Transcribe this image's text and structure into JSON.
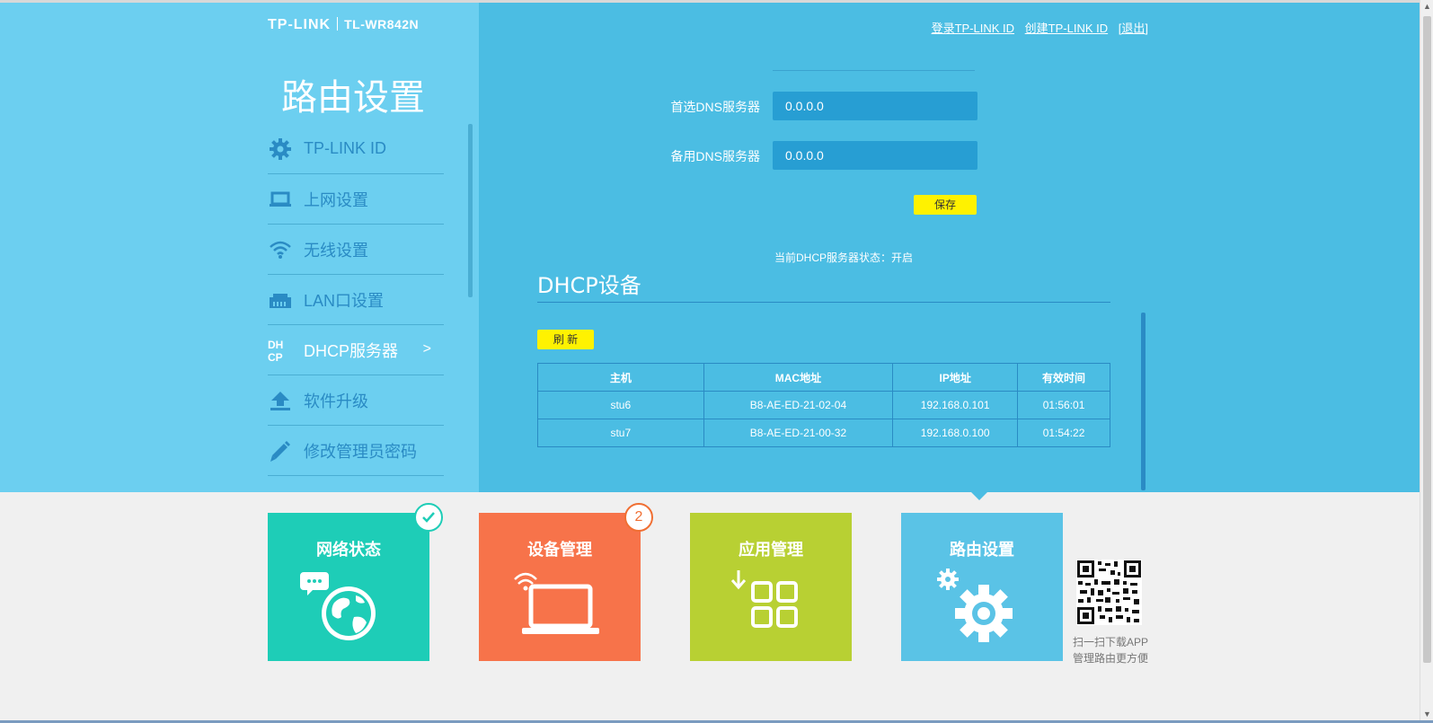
{
  "header": {
    "brand": "TP-LINK",
    "model": "TL-WR842N",
    "links": [
      "登录TP-LINK ID",
      "创建TP-LINK ID",
      "[退出]"
    ]
  },
  "sidebar": {
    "title": "路由设置",
    "items": [
      {
        "label": "TP-LINK ID",
        "icon": "gear-icon"
      },
      {
        "label": "上网设置",
        "icon": "laptop-icon"
      },
      {
        "label": "无线设置",
        "icon": "wifi-icon"
      },
      {
        "label": "LAN口设置",
        "icon": "lan-port-icon"
      },
      {
        "label": "DHCP服务器",
        "icon": "dhcp-icon",
        "active": true,
        "arrow": ">"
      },
      {
        "label": "软件升级",
        "icon": "upload-icon"
      },
      {
        "label": "修改管理员密码",
        "icon": "pencil-icon"
      }
    ]
  },
  "form": {
    "dns1_label": "首选DNS服务器",
    "dns1_value": "0.0.0.0",
    "dns2_label": "备用DNS服务器",
    "dns2_value": "0.0.0.0",
    "save_label": "保存"
  },
  "dhcp": {
    "status": "当前DHCP服务器状态：开启",
    "title": "DHCP设备",
    "refresh_label": "刷 新",
    "columns": [
      "主机",
      "MAC地址",
      "IP地址",
      "有效时间"
    ],
    "rows": [
      [
        "stu6",
        "B8-AE-ED-21-02-04",
        "192.168.0.101",
        "01:56:01"
      ],
      [
        "stu7",
        "B8-AE-ED-21-00-32",
        "192.168.0.100",
        "01:54:22"
      ]
    ]
  },
  "tiles": [
    {
      "label": "网络状态",
      "color": "#1ecdb7",
      "icon": "globe-icon"
    },
    {
      "label": "设备管理",
      "color": "#f7734a",
      "icon": "laptop-wifi-icon",
      "badge": "2"
    },
    {
      "label": "应用管理",
      "color": "#b8d033",
      "icon": "apps-grid-icon"
    },
    {
      "label": "路由设置",
      "color": "#5ac3e6",
      "icon": "gears-icon"
    }
  ],
  "qr": {
    "line1": "扫一扫下载APP",
    "line2": "管理路由更方便"
  },
  "colors": {
    "sidebar_bg": "#6ccff0",
    "main_bg": "#4bbde3",
    "accent_dark": "#2a8bc4",
    "button_yellow": "#fff200"
  }
}
